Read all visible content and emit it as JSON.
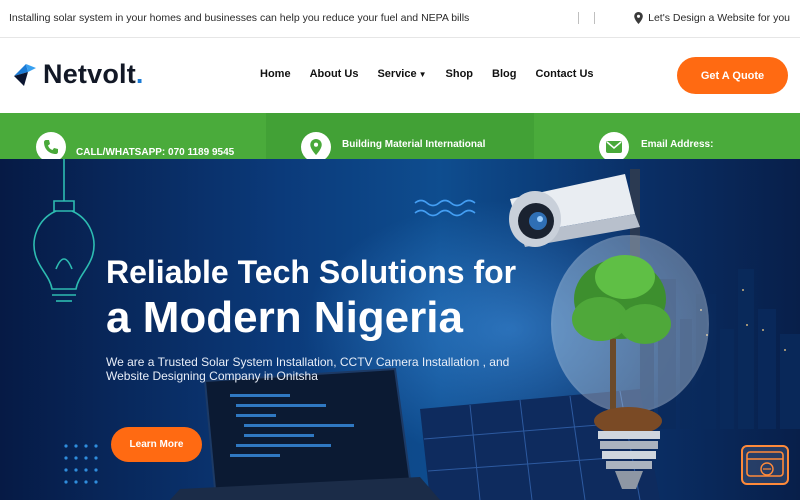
{
  "topbar": {
    "tagline": "Installing solar system in your homes and businesses can help you reduce your fuel and NEPA bills",
    "right_link": "Let's Design a Website for you"
  },
  "header": {
    "logo_text": "Netvolt",
    "logo_dot": ".",
    "nav": [
      {
        "label": "Home"
      },
      {
        "label": "About Us"
      },
      {
        "label": "Service"
      },
      {
        "label": "Shop"
      },
      {
        "label": "Blog"
      },
      {
        "label": "Contact Us"
      }
    ],
    "quote_button": "Get A Quote"
  },
  "info_strip": {
    "phone": "CALL/WHATSAPP: 070 1189 9545",
    "address_title": "Building Material International",
    "email_title": "Email Address:"
  },
  "hero": {
    "title_line1": "Reliable Tech Solutions for",
    "title_line2": "a Modern Nigeria",
    "subtitle": "We are a Trusted Solar System Installation, CCTV Camera Installation , and Website Designing Company in Onitsha",
    "cta": "Learn More"
  },
  "colors": {
    "accent_orange": "#ff6a12",
    "green_strip": "#49a93a",
    "hero_blue": "#0b3a7a"
  }
}
